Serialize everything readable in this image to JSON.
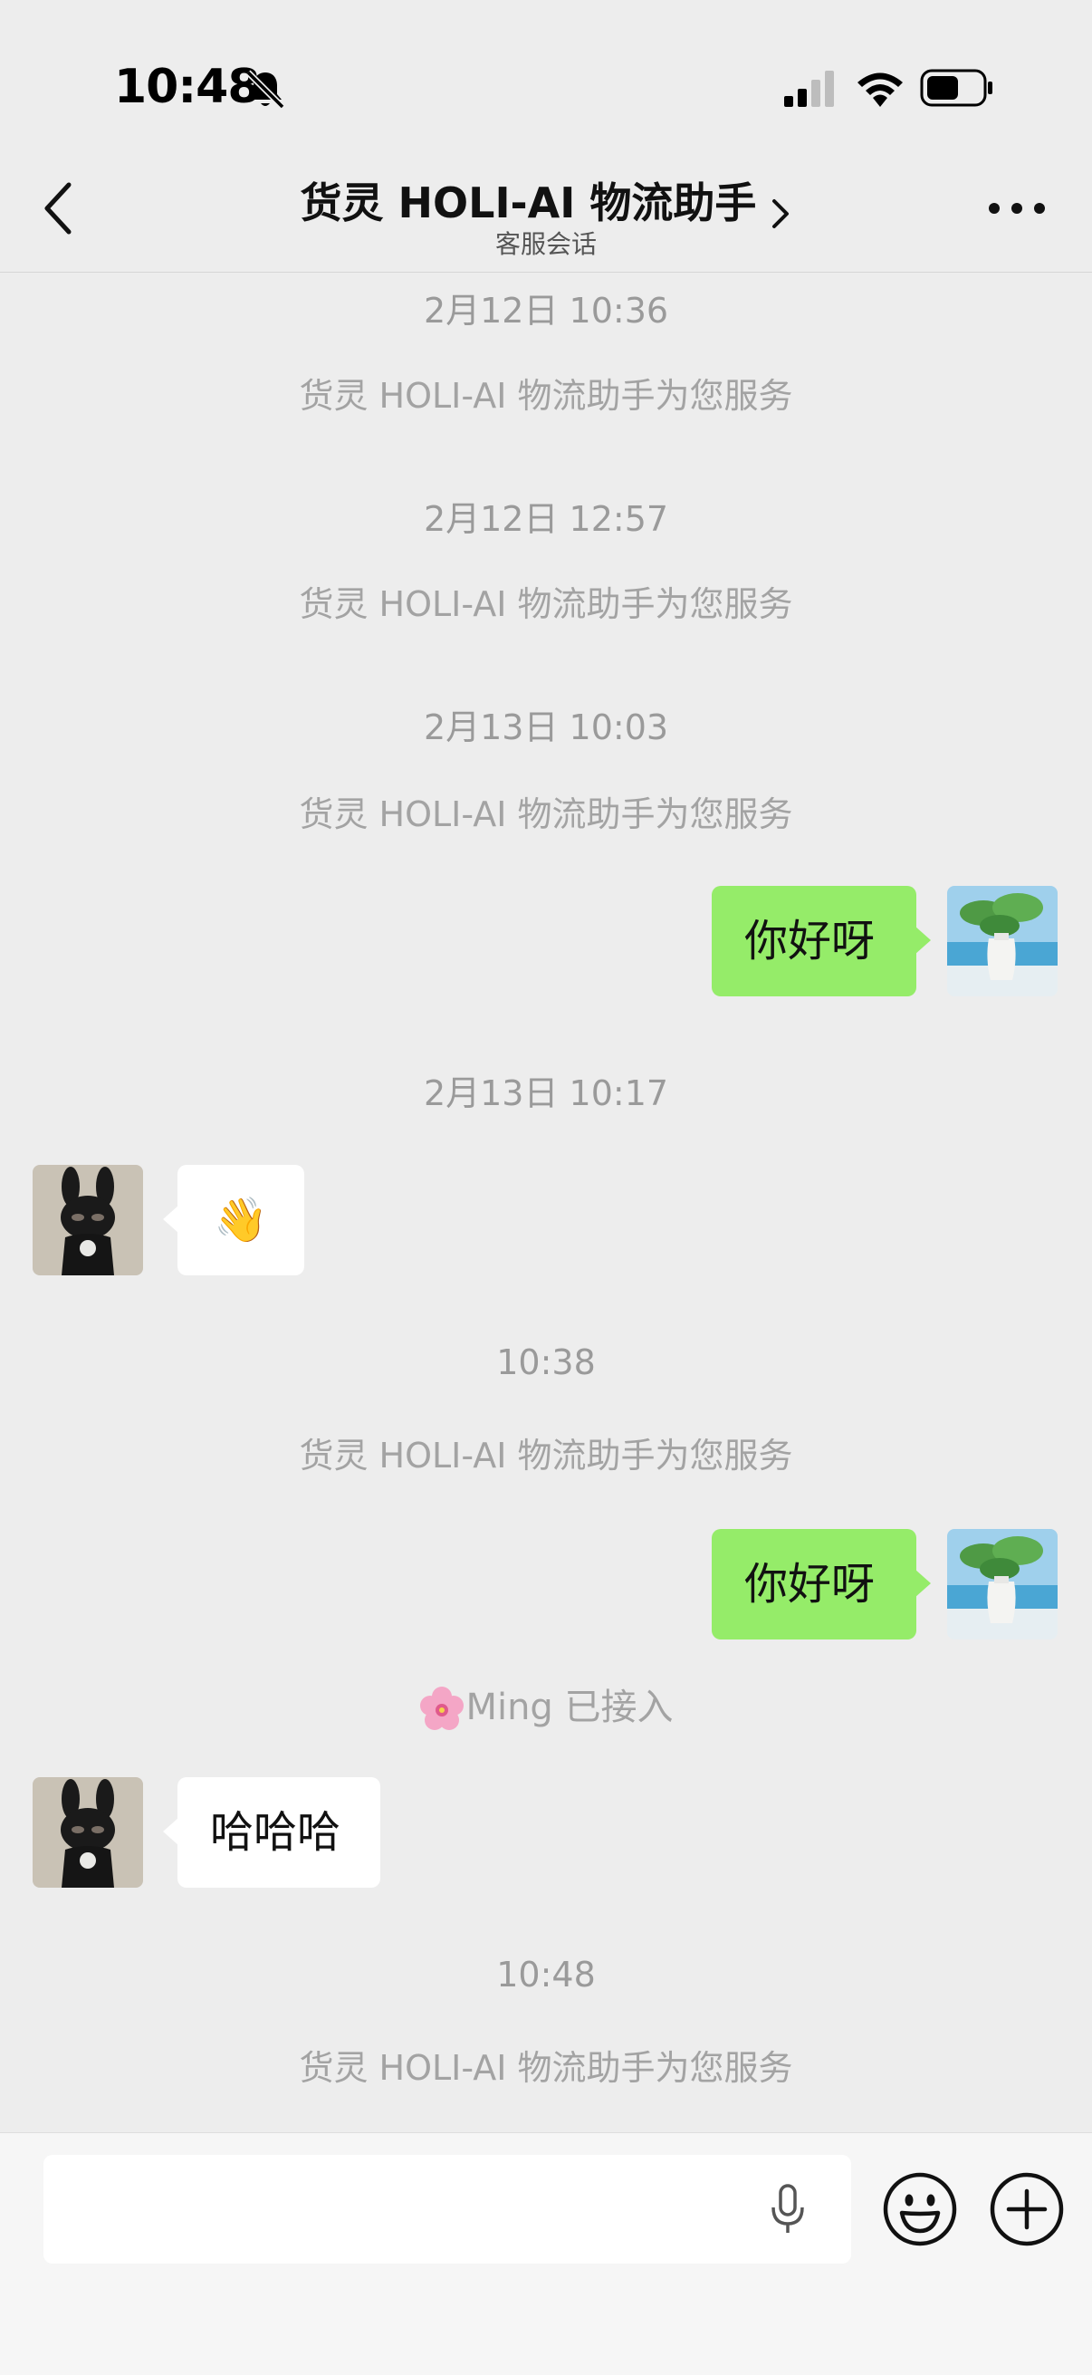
{
  "status_bar": {
    "time": "10:48",
    "icons": [
      "bell-slash-icon",
      "signal-icon",
      "wifi-icon",
      "battery-icon"
    ]
  },
  "header": {
    "title": "货灵 HOLI-AI 物流助手",
    "subtitle": "客服会话",
    "icons": [
      "back-icon",
      "chevron-right-icon",
      "more-icon"
    ]
  },
  "chat": {
    "timestamps": [
      "2月12日 10:36",
      "2月12日 12:57",
      "2月13日 10:03",
      "2月13日 10:17",
      "10:38",
      "10:48"
    ],
    "system_message": "货灵 HOLI-AI 物流助手为您服务",
    "messages": [
      {
        "from": "me",
        "text": "你好呀"
      },
      {
        "from": "other",
        "text": "👋"
      },
      {
        "from": "me",
        "text": "你好呀"
      },
      {
        "from": "other",
        "text": "哈哈哈"
      }
    ],
    "agent_joined": "Ming 已接入",
    "agent_joined_icon": "flower-icon"
  },
  "input_bar": {
    "value": "",
    "placeholder": "",
    "icons": [
      "mic-icon",
      "emoji-icon",
      "plus-icon"
    ]
  },
  "colors": {
    "background": "#ededed",
    "my_bubble": "#95ec69",
    "other_bubble": "#ffffff"
  }
}
